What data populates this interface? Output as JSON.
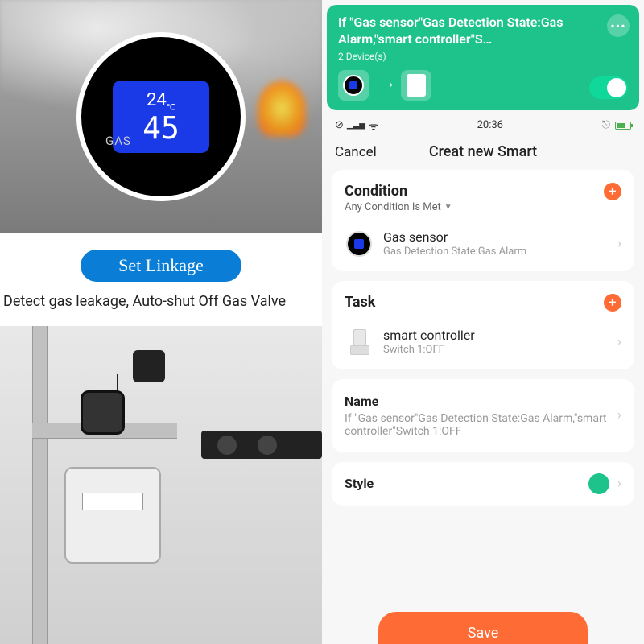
{
  "left": {
    "device": {
      "temp": "24",
      "temp_unit": "℃",
      "reading": "45",
      "gas_label": "GAS"
    },
    "linkage_button": "Set Linkage",
    "caption": "Detect gas leakage, Auto-shut Off Gas Valve"
  },
  "banner": {
    "title": "If \"Gas sensor\"Gas Detection State:Gas Alarm,\"smart controller\"S…",
    "subtitle": "2 Device(s)",
    "more": "•••"
  },
  "statusbar": {
    "time": "20:36"
  },
  "nav": {
    "cancel": "Cancel",
    "title": "Creat new Smart"
  },
  "condition": {
    "title": "Condition",
    "mode": "Any Condition Is Met",
    "item": {
      "name": "Gas sensor",
      "detail": "Gas Detection State:Gas Alarm"
    }
  },
  "task": {
    "title": "Task",
    "item": {
      "name": "smart controller",
      "detail": "Switch 1:OFF"
    }
  },
  "name_row": {
    "label": "Name",
    "value": "If \"Gas sensor\"Gas Detection State:Gas Alarm,\"smart controller\"Switch 1:OFF"
  },
  "style_row": {
    "label": "Style"
  },
  "save": "Save"
}
